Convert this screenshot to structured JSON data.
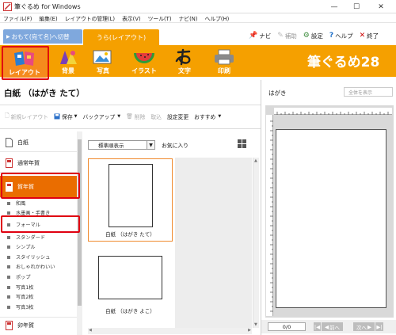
{
  "window": {
    "title": "筆ぐるめ for Windows",
    "controls": {
      "minimize": "—",
      "maximize": "☐",
      "close": "✕"
    }
  },
  "menu": [
    "ファイル(F)",
    "編集(E)",
    "レイアウトの管理(L)",
    "表示(V)",
    "ツール(T)",
    "ナビ(N)",
    "ヘルプ(H)"
  ],
  "side_tabs": {
    "front": "おもて(宛て名)へ切替",
    "back": "うら(レイアウト)"
  },
  "top_links": {
    "navi": "ナビ",
    "assist": "補助",
    "settings": "設定",
    "help": "ヘルプ",
    "exit": "終了"
  },
  "ribbon": {
    "buttons": [
      "レイアウト",
      "背景",
      "写真",
      "イラスト",
      "文字",
      "印刷"
    ],
    "brand": "筆ぐるめ28",
    "colors": {
      "ribbon": "#f5a000",
      "active": "#f58a1d"
    }
  },
  "workspace": {
    "title": "白紙 （はがき たて）"
  },
  "toolbar": {
    "new_layout": "新規レイアウト",
    "save": "保存",
    "backup": "バックアップ",
    "delete": "削除",
    "import": "取込",
    "change_settings": "設定変更",
    "recommended": "おすすめ"
  },
  "categories": {
    "top": [
      {
        "label": "白紙"
      },
      {
        "label": "通常年賀"
      },
      {
        "label": "賀年賀"
      }
    ],
    "sub_items": [
      "和風",
      "水墨画・手書き",
      "フォーマル",
      "スタンダード",
      "シンプル",
      "スタイリッシュ",
      "おしゃれかわいい",
      "ポップ",
      "写真1枚",
      "写真2枚",
      "写真3枚"
    ],
    "bottom": {
      "label": "卯年賀"
    },
    "highlight_color": "#e00010",
    "selected_color": "#ea6d00"
  },
  "templates": {
    "sort": "標準順表示",
    "favorite": "お気に入り",
    "cards": [
      {
        "caption": "白紙 （はがき たて）"
      },
      {
        "caption": "白紙 （はがき よこ）"
      }
    ]
  },
  "preview": {
    "title": "はがき",
    "zoom": "全体を表示",
    "page_count": "0/0",
    "prev": "前へ",
    "next": "次へ"
  }
}
